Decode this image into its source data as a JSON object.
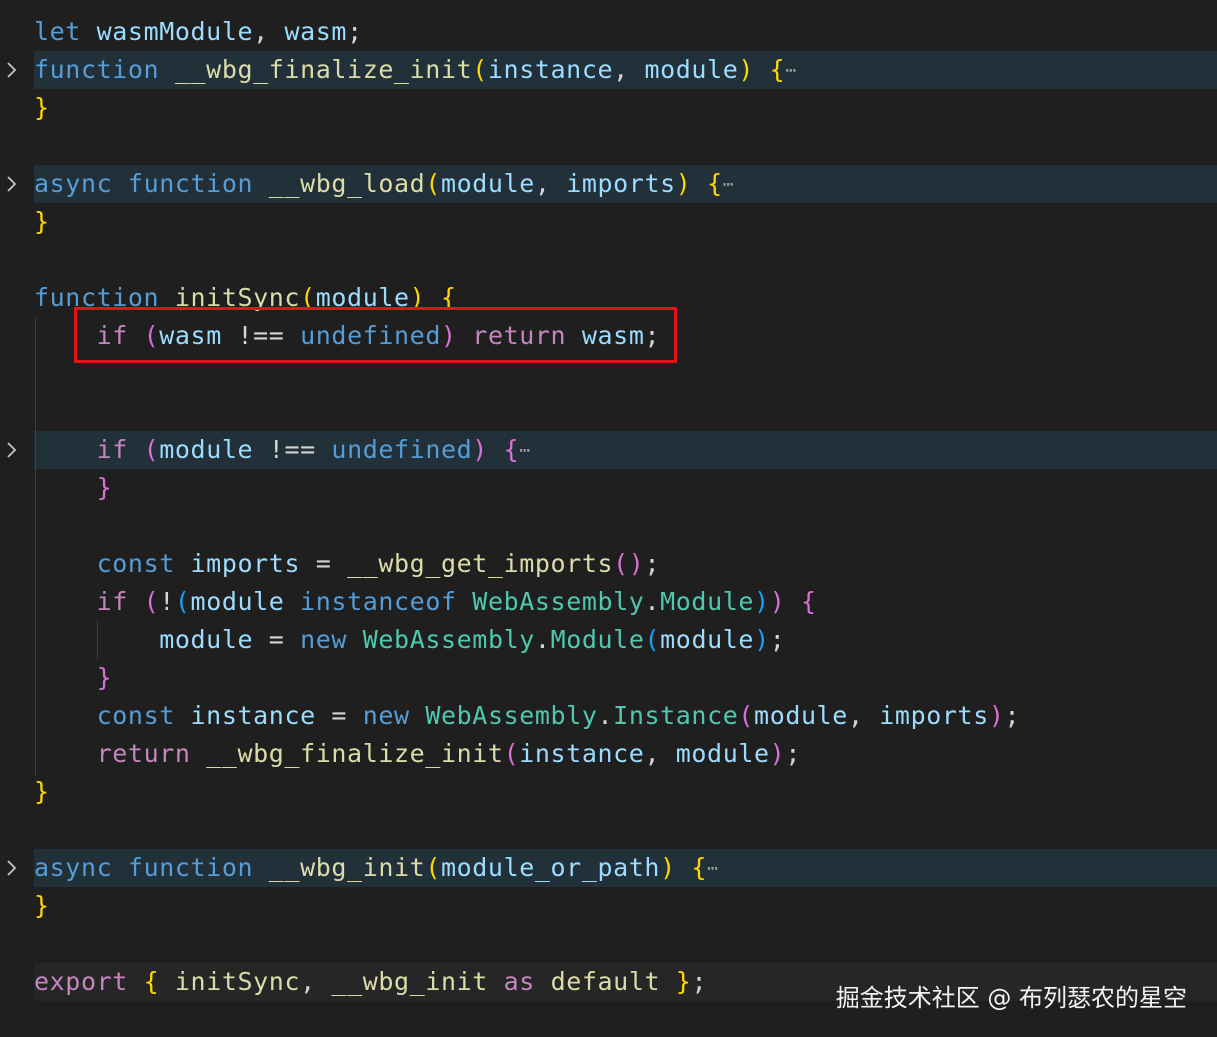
{
  "editor": {
    "lines": [
      {
        "id": "l1",
        "tokens": [
          [
            "kw",
            "let"
          ],
          [
            "pun",
            " "
          ],
          [
            "var",
            "wasmModule"
          ],
          [
            "pun",
            ", "
          ],
          [
            "var",
            "wasm"
          ],
          [
            "pun",
            ";"
          ]
        ]
      },
      {
        "id": "l2",
        "tokens": [
          [
            "kw",
            "function"
          ],
          [
            "pun",
            " "
          ],
          [
            "fn",
            "__wbg_finalize_init"
          ],
          [
            "b1",
            "("
          ],
          [
            "var",
            "instance"
          ],
          [
            "pun",
            ", "
          ],
          [
            "var",
            "module"
          ],
          [
            "b1",
            ")"
          ],
          [
            "pun",
            " "
          ],
          [
            "b1",
            "{"
          ]
        ],
        "folded": true
      },
      {
        "id": "l3",
        "tokens": [
          [
            "b1",
            "}"
          ]
        ]
      },
      {
        "id": "l4",
        "tokens": [
          [
            "kw",
            "async"
          ],
          [
            "pun",
            " "
          ],
          [
            "kw",
            "function"
          ],
          [
            "pun",
            " "
          ],
          [
            "fn",
            "__wbg_load"
          ],
          [
            "b1",
            "("
          ],
          [
            "var",
            "module"
          ],
          [
            "pun",
            ", "
          ],
          [
            "var",
            "imports"
          ],
          [
            "b1",
            ")"
          ],
          [
            "pun",
            " "
          ],
          [
            "b1",
            "{"
          ]
        ],
        "folded": true
      },
      {
        "id": "l5",
        "tokens": [
          [
            "b1",
            "}"
          ]
        ]
      },
      {
        "id": "l6",
        "tokens": [
          [
            "kw",
            "function"
          ],
          [
            "pun",
            " "
          ],
          [
            "fn",
            "initSync"
          ],
          [
            "b1",
            "("
          ],
          [
            "var",
            "module"
          ],
          [
            "b1",
            ")"
          ],
          [
            "pun",
            " "
          ],
          [
            "b1",
            "{"
          ]
        ]
      },
      {
        "id": "l7",
        "tokens": [
          [
            "pun",
            "    "
          ],
          [
            "ctl",
            "if"
          ],
          [
            "pun",
            " "
          ],
          [
            "b2",
            "("
          ],
          [
            "var",
            "wasm"
          ],
          [
            "pun",
            " !== "
          ],
          [
            "kw",
            "undefined"
          ],
          [
            "b2",
            ")"
          ],
          [
            "pun",
            " "
          ],
          [
            "ctl",
            "return"
          ],
          [
            "pun",
            " "
          ],
          [
            "var",
            "wasm"
          ],
          [
            "pun",
            ";"
          ]
        ]
      },
      {
        "id": "l8",
        "tokens": [
          [
            "pun",
            "    "
          ],
          [
            "ctl",
            "if"
          ],
          [
            "pun",
            " "
          ],
          [
            "b2",
            "("
          ],
          [
            "var",
            "module"
          ],
          [
            "pun",
            " !== "
          ],
          [
            "kw",
            "undefined"
          ],
          [
            "b2",
            ")"
          ],
          [
            "pun",
            " "
          ],
          [
            "b2",
            "{"
          ]
        ],
        "folded": true
      },
      {
        "id": "l9",
        "tokens": [
          [
            "pun",
            "    "
          ],
          [
            "b2",
            "}"
          ]
        ]
      },
      {
        "id": "l10",
        "tokens": [
          [
            "pun",
            "    "
          ],
          [
            "kw",
            "const"
          ],
          [
            "pun",
            " "
          ],
          [
            "var",
            "imports"
          ],
          [
            "pun",
            " = "
          ],
          [
            "fn",
            "__wbg_get_imports"
          ],
          [
            "b2",
            "()"
          ],
          [
            "pun",
            ";"
          ]
        ]
      },
      {
        "id": "l11",
        "tokens": [
          [
            "pun",
            "    "
          ],
          [
            "ctl",
            "if"
          ],
          [
            "pun",
            " "
          ],
          [
            "b2",
            "("
          ],
          [
            "pun",
            "!"
          ],
          [
            "b3",
            "("
          ],
          [
            "var",
            "module"
          ],
          [
            "pun",
            " "
          ],
          [
            "kw",
            "instanceof"
          ],
          [
            "pun",
            " "
          ],
          [
            "cls",
            "WebAssembly"
          ],
          [
            "pun",
            "."
          ],
          [
            "cls",
            "Module"
          ],
          [
            "b3",
            ")"
          ],
          [
            "b2",
            ")"
          ],
          [
            "pun",
            " "
          ],
          [
            "b2",
            "{"
          ]
        ]
      },
      {
        "id": "l12",
        "tokens": [
          [
            "pun",
            "        "
          ],
          [
            "var",
            "module"
          ],
          [
            "pun",
            " = "
          ],
          [
            "kw",
            "new"
          ],
          [
            "pun",
            " "
          ],
          [
            "cls",
            "WebAssembly"
          ],
          [
            "pun",
            "."
          ],
          [
            "cls",
            "Module"
          ],
          [
            "b3",
            "("
          ],
          [
            "var",
            "module"
          ],
          [
            "b3",
            ")"
          ],
          [
            "pun",
            ";"
          ]
        ]
      },
      {
        "id": "l13",
        "tokens": [
          [
            "pun",
            "    "
          ],
          [
            "b2",
            "}"
          ]
        ]
      },
      {
        "id": "l14",
        "tokens": [
          [
            "pun",
            "    "
          ],
          [
            "kw",
            "const"
          ],
          [
            "pun",
            " "
          ],
          [
            "var",
            "instance"
          ],
          [
            "pun",
            " = "
          ],
          [
            "kw",
            "new"
          ],
          [
            "pun",
            " "
          ],
          [
            "cls",
            "WebAssembly"
          ],
          [
            "pun",
            "."
          ],
          [
            "cls",
            "Instance"
          ],
          [
            "b2",
            "("
          ],
          [
            "var",
            "module"
          ],
          [
            "pun",
            ", "
          ],
          [
            "var",
            "imports"
          ],
          [
            "b2",
            ")"
          ],
          [
            "pun",
            ";"
          ]
        ]
      },
      {
        "id": "l15",
        "tokens": [
          [
            "pun",
            "    "
          ],
          [
            "ctl",
            "return"
          ],
          [
            "pun",
            " "
          ],
          [
            "fn",
            "__wbg_finalize_init"
          ],
          [
            "b2",
            "("
          ],
          [
            "var",
            "instance"
          ],
          [
            "pun",
            ", "
          ],
          [
            "var",
            "module"
          ],
          [
            "b2",
            ")"
          ],
          [
            "pun",
            ";"
          ]
        ]
      },
      {
        "id": "l16",
        "tokens": [
          [
            "b1",
            "}"
          ]
        ]
      },
      {
        "id": "l17",
        "tokens": [
          [
            "kw",
            "async"
          ],
          [
            "pun",
            " "
          ],
          [
            "kw",
            "function"
          ],
          [
            "pun",
            " "
          ],
          [
            "fn",
            "__wbg_init"
          ],
          [
            "b1",
            "("
          ],
          [
            "var",
            "module_or_path"
          ],
          [
            "b1",
            ")"
          ],
          [
            "pun",
            " "
          ],
          [
            "b1",
            "{"
          ]
        ],
        "folded": true
      },
      {
        "id": "l18",
        "tokens": [
          [
            "b1",
            "}"
          ]
        ]
      },
      {
        "id": "l19",
        "tokens": [
          [
            "ctl",
            "export"
          ],
          [
            "pun",
            " "
          ],
          [
            "b1",
            "{"
          ],
          [
            "pun",
            " "
          ],
          [
            "fn",
            "initSync"
          ],
          [
            "pun",
            ", "
          ],
          [
            "fn",
            "__wbg_init"
          ],
          [
            "pun",
            " "
          ],
          [
            "ctl",
            "as"
          ],
          [
            "pun",
            " "
          ],
          [
            "fn",
            "default"
          ],
          [
            "pun",
            " "
          ],
          [
            "b1",
            "}"
          ],
          [
            "pun",
            ";"
          ]
        ]
      }
    ],
    "ellipsis": "⋯"
  },
  "watermark": "掘金技术社区 @ 布列瑟农的星空",
  "highlight_color": "#e0151b"
}
